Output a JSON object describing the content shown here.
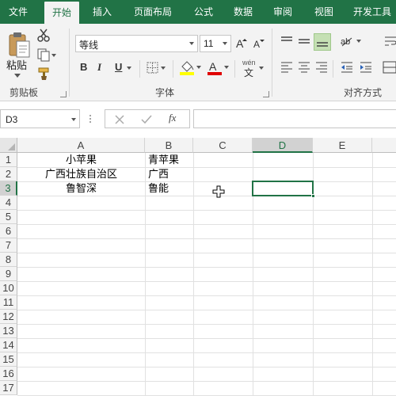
{
  "tabs": [
    {
      "label": "文件",
      "active": false
    },
    {
      "label": "开始",
      "active": true
    },
    {
      "label": "插入",
      "active": false
    },
    {
      "label": "页面布局",
      "active": false
    },
    {
      "label": "公式",
      "active": false
    },
    {
      "label": "数据",
      "active": false
    },
    {
      "label": "审阅",
      "active": false
    },
    {
      "label": "视图",
      "active": false
    },
    {
      "label": "开发工具",
      "active": false
    }
  ],
  "ribbon": {
    "clipboard": {
      "paste_label": "粘贴",
      "group_label": "剪贴板"
    },
    "font": {
      "font_name": "等线",
      "font_size": "11",
      "bold": "B",
      "italic": "I",
      "underline": "U",
      "group_label": "字体",
      "phonetic_label": "wén",
      "phonetic_char": "文"
    },
    "alignment": {
      "group_label": "对齐方式"
    }
  },
  "formula_bar": {
    "name_box": "D3",
    "formula_value": "",
    "fx_label": "fx"
  },
  "grid": {
    "columns": [
      "A",
      "B",
      "C",
      "D",
      "E"
    ],
    "rows": [
      "1",
      "2",
      "3",
      "4",
      "5",
      "6",
      "7",
      "8",
      "9",
      "10",
      "11",
      "12",
      "13",
      "14",
      "15",
      "16",
      "17"
    ],
    "selected_column": "D",
    "selected_row": "3",
    "cells": {
      "A1": "小苹果",
      "B1": "青苹果",
      "A2": "广西壮族自治区",
      "B2": "广西",
      "A3": "鲁智深",
      "B3": "鲁能"
    }
  },
  "colors": {
    "accent": "#217346",
    "ribbon_bg": "#f3f3f3",
    "header_selected": "#d2d2d2"
  }
}
